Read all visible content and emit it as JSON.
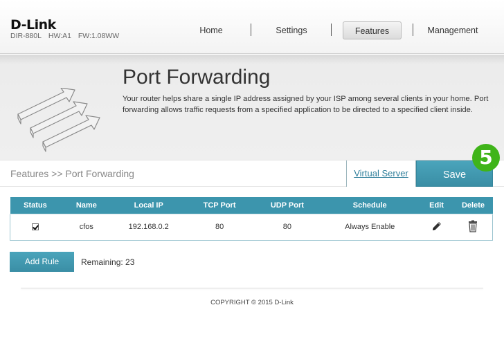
{
  "header": {
    "logo": "D-Link",
    "model": "DIR-880L",
    "hw": "HW:A1",
    "fw": "FW:1.08WW",
    "nav": [
      {
        "label": "Home",
        "active": false
      },
      {
        "label": "Settings",
        "active": false
      },
      {
        "label": "Features",
        "active": true
      },
      {
        "label": "Management",
        "active": false
      }
    ]
  },
  "banner": {
    "title": "Port Forwarding",
    "description": "Your router helps share a single IP address assigned by your ISP among several clients in your home. Port forwarding allows traffic requests from a specified application to be directed to a specified client inside."
  },
  "breadcrumb": "Features >> Port Forwarding",
  "actions": {
    "virtual_server": "Virtual Server",
    "save": "Save",
    "step_badge": "5"
  },
  "table": {
    "columns": [
      "Status",
      "Name",
      "Local IP",
      "TCP Port",
      "UDP Port",
      "Schedule",
      "Edit",
      "Delete"
    ],
    "rows": [
      {
        "status": true,
        "name": "cfos",
        "local_ip": "192.168.0.2",
        "tcp_port": "80",
        "udp_port": "80",
        "schedule": "Always Enable",
        "edit_icon": "pencil-icon",
        "delete_icon": "trash-icon"
      }
    ]
  },
  "add_rule": {
    "label": "Add Rule",
    "remaining": "Remaining: 23"
  },
  "footer": {
    "copyright": "COPYRIGHT © 2015 D-Link"
  },
  "colors": {
    "accent": "#3c95ad",
    "badge": "#3fb419"
  }
}
